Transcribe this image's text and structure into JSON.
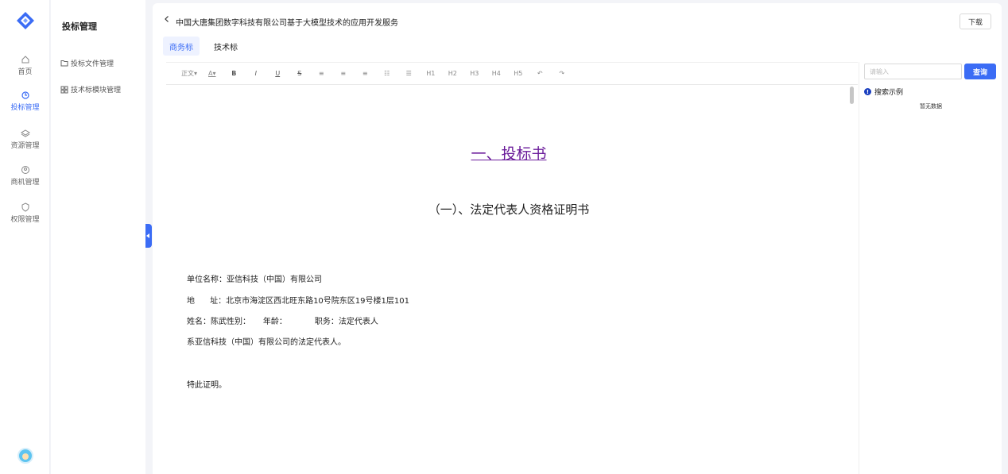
{
  "app": {
    "nav": [
      {
        "label": "首页",
        "icon": "home-icon"
      },
      {
        "label": "投标管理",
        "icon": "bid-icon",
        "active": true
      },
      {
        "label": "资源管理",
        "icon": "layers-icon"
      },
      {
        "label": "商机管理",
        "icon": "chat-icon"
      },
      {
        "label": "权限管理",
        "icon": "shield-icon"
      }
    ],
    "accent": "#3b6cf5"
  },
  "submenu": {
    "title": "投标管理",
    "items": [
      {
        "label": "投标文件管理",
        "icon": "folder-icon"
      },
      {
        "label": "技术标模块管理",
        "icon": "grid-icon"
      }
    ]
  },
  "header": {
    "title": "中国大唐集团数字科技有限公司基于大模型技术的应用开发服务",
    "download_label": "下载"
  },
  "tabs": [
    {
      "label": "商务标",
      "active": true
    },
    {
      "label": "技术标",
      "active": false
    }
  ],
  "toolbar": {
    "paragraph": "正文▾",
    "font_color": "A▾",
    "bold": "B",
    "italic": "I",
    "underline": "U",
    "strike": "S",
    "align_left": "≡",
    "align_center": "≡",
    "align_right": "≡",
    "bullet_list": "☷",
    "ordered_list": "☰",
    "h1": "H1",
    "h2": "H2",
    "h3": "H3",
    "h4": "H4",
    "h5": "H5",
    "undo": "↶",
    "redo": "↷"
  },
  "document": {
    "heading1": "一、投标书",
    "heading2": "（一）、法定代表人资格证明书",
    "lines": [
      "单位名称：亚信科技（中国）有限公司",
      "地      址：北京市海淀区西北旺东路10号院东区19号楼1层101",
      "姓名：陈武性别：     年龄：           职务：法定代表人",
      "系亚信科技（中国）有限公司的法定代表人。",
      "特此证明。"
    ]
  },
  "search": {
    "placeholder": "请输入",
    "button_label": "查询",
    "example_label": "搜索示例",
    "empty_text": "暂无数据"
  }
}
